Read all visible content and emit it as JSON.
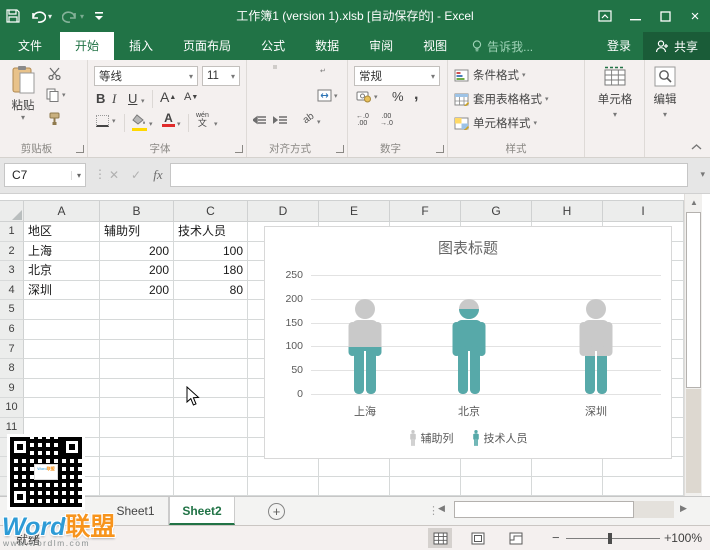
{
  "titlebar": {
    "title": "工作簿1 (version 1).xlsb [自动保存的] - Excel"
  },
  "menu": {
    "file": "文件",
    "tabs": [
      "开始",
      "插入",
      "页面布局",
      "公式",
      "数据",
      "审阅",
      "视图"
    ],
    "active_tab": "开始",
    "tell_me": "告诉我...",
    "sign_in": "登录",
    "share": "共享"
  },
  "ribbon": {
    "clipboard": {
      "paste": "粘贴",
      "label": "剪贴板"
    },
    "font": {
      "family": "等线",
      "size": "11",
      "bold": "B",
      "italic": "I",
      "underline": "U",
      "grow": "A",
      "shrink": "A",
      "color": "A",
      "phonetic_top": "wén",
      "phonetic_bottom": "文",
      "label": "字体"
    },
    "alignment": {
      "label": "对齐方式",
      "orientation": "ab"
    },
    "number": {
      "format": "常规",
      "percent": "%",
      "comma": ",",
      "inc_top": "←.0",
      "inc_bottom": ".00",
      "dec_top": ".00",
      "dec_bottom": "→.0",
      "label": "数字"
    },
    "styles": {
      "items": [
        "条件格式",
        "套用表格格式",
        "单元格样式"
      ],
      "label": "样式"
    },
    "cells": {
      "label": "单元格"
    },
    "editing": {
      "label": "编辑"
    }
  },
  "formula_bar": {
    "name_box": "C7",
    "cancel": "✕",
    "enter": "✓",
    "fx": "fx",
    "value": ""
  },
  "sheet": {
    "columns": [
      "A",
      "B",
      "C",
      "D",
      "E",
      "F",
      "G",
      "H",
      "I"
    ],
    "row_numbers": [
      1,
      2,
      3,
      4,
      5,
      6,
      7,
      8,
      9,
      10,
      11
    ],
    "cells": [
      [
        "地区",
        "辅助列",
        "技术人员"
      ],
      [
        "上海",
        "200",
        "100"
      ],
      [
        "北京",
        "200",
        "180"
      ],
      [
        "深圳",
        "200",
        "80"
      ]
    ]
  },
  "chart_data": {
    "type": "bar",
    "subtype": "pictograph-people-overlap",
    "title": "图表标题",
    "categories": [
      "上海",
      "北京",
      "深圳"
    ],
    "series": [
      {
        "name": "辅助列",
        "values": [
          200,
          200,
          200
        ],
        "color": "#c9c9c9"
      },
      {
        "name": "技术人员",
        "values": [
          100,
          180,
          80
        ],
        "color": "#57a9a9"
      }
    ],
    "ylim": [
      0,
      250
    ],
    "yticks": [
      0,
      50,
      100,
      150,
      200,
      250
    ],
    "grid": true,
    "legend_position": "bottom"
  },
  "sheet_tabs": {
    "tabs": [
      "Sheet1",
      "Sheet2"
    ],
    "active": "Sheet2"
  },
  "status_bar": {
    "mode": "就绪",
    "zoom": "100%"
  },
  "watermark": {
    "brand_left": "Word",
    "brand_right": "联盟",
    "url": "www.wordlm.com",
    "qr_line1": "Word",
    "qr_line2": "联盟"
  },
  "colors": {
    "excel_green": "#217346",
    "share_green": "#1a5c38",
    "teal": "#57a9a9",
    "series_gray": "#c9c9c9",
    "fill_yellow": "#ffd800",
    "font_red": "#e02b2b"
  }
}
